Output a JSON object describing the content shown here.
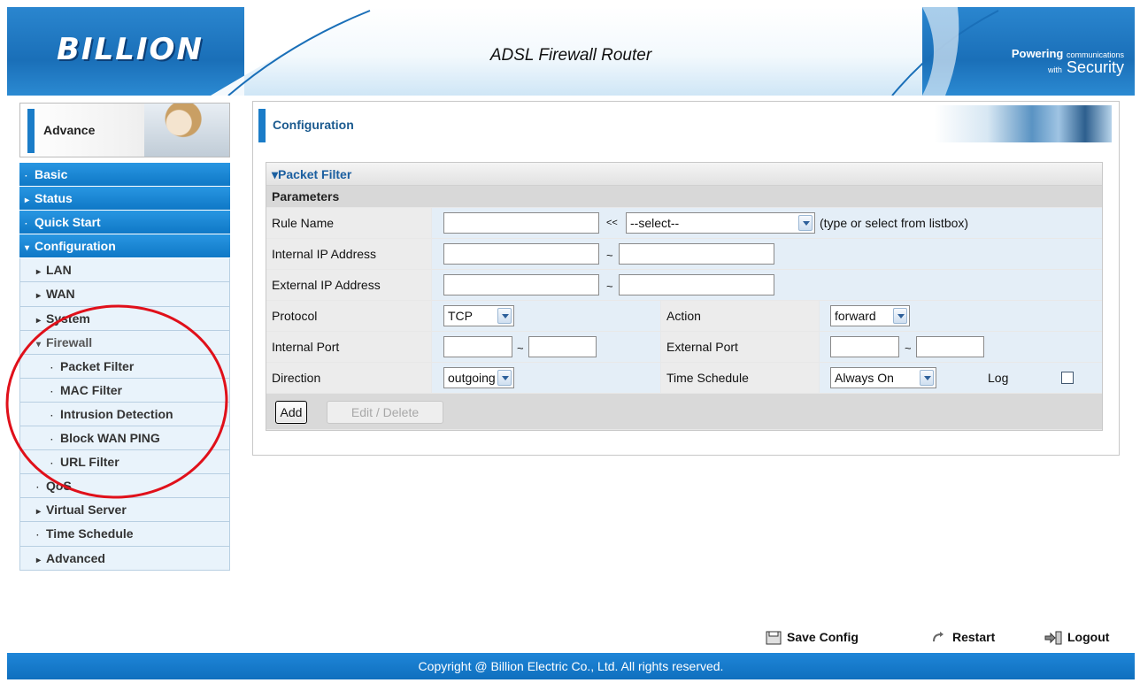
{
  "header": {
    "logo": "BILLION",
    "title": "ADSL Firewall Router",
    "tagline_bold": "Powering",
    "tagline_small1": "communications",
    "tagline_small2": "with",
    "tagline_big": "Security"
  },
  "sidebar": {
    "section_label": "Advance",
    "items": [
      {
        "label": "Basic",
        "glyph": "·",
        "level": "top"
      },
      {
        "label": "Status",
        "glyph": "▸",
        "level": "top"
      },
      {
        "label": "Quick Start",
        "glyph": "·",
        "level": "top"
      },
      {
        "label": "Configuration",
        "glyph": "▾",
        "level": "top"
      },
      {
        "label": "LAN",
        "glyph": "▸",
        "level": "sub"
      },
      {
        "label": "WAN",
        "glyph": "▸",
        "level": "sub"
      },
      {
        "label": "System",
        "glyph": "▸",
        "level": "sub"
      },
      {
        "label": "Firewall",
        "glyph": "▾",
        "level": "sub"
      },
      {
        "label": "Packet Filter",
        "glyph": "·",
        "level": "sub2"
      },
      {
        "label": "MAC Filter",
        "glyph": "·",
        "level": "sub2"
      },
      {
        "label": "Intrusion Detection",
        "glyph": "·",
        "level": "sub2"
      },
      {
        "label": "Block WAN PING",
        "glyph": "·",
        "level": "sub2"
      },
      {
        "label": "URL Filter",
        "glyph": "·",
        "level": "sub2"
      },
      {
        "label": "QoS",
        "glyph": "·",
        "level": "sub"
      },
      {
        "label": "Virtual Server",
        "glyph": "▸",
        "level": "sub"
      },
      {
        "label": "Time Schedule",
        "glyph": "·",
        "level": "sub"
      },
      {
        "label": "Advanced",
        "glyph": "▸",
        "level": "sub"
      }
    ]
  },
  "main": {
    "section_title": "Configuration",
    "panel_title": "▾Packet Filter",
    "params_label": "Parameters",
    "rule_name_label": "Rule Name",
    "rule_name_arrow": "<<",
    "rule_name_select": "--select--",
    "rule_name_hint": "(type or select from listbox)",
    "internal_ip_label": "Internal IP Address",
    "external_ip_label": "External IP Address",
    "range_sep": "~",
    "protocol_label": "Protocol",
    "protocol_value": "TCP",
    "action_label": "Action",
    "action_value": "forward",
    "internal_port_label": "Internal Port",
    "external_port_label": "External Port",
    "direction_label": "Direction",
    "direction_value": "outgoing",
    "time_schedule_label": "Time Schedule",
    "time_schedule_value": "Always On",
    "log_label": "Log",
    "log_checked": false,
    "add_button": "Add",
    "edit_delete_button": "Edit / Delete"
  },
  "footer": {
    "save_config": "Save Config",
    "restart": "Restart",
    "logout": "Logout",
    "copyright": "Copyright @ Billion Electric Co., Ltd. All rights reserved."
  },
  "colors": {
    "brand_blue": "#0f78c6",
    "annotation_red": "#e0101a"
  }
}
